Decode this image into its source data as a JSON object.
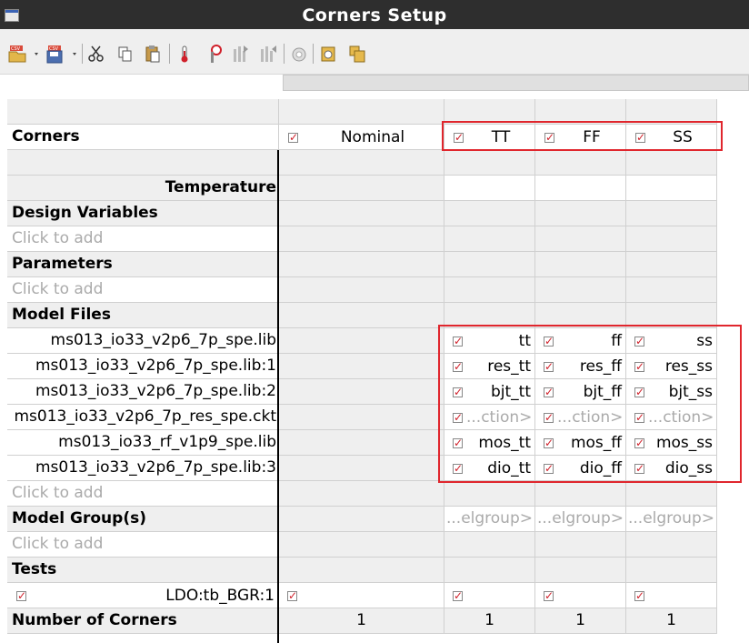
{
  "window": {
    "title": "Corners Setup"
  },
  "toolbar": {
    "icons": [
      "open-csv-icon",
      "save-csv-icon",
      "cut-icon",
      "copy-icon",
      "paste-icon",
      "add-temperature-icon",
      "add-variable-icon",
      "add-model-icon",
      "add-parameter-icon",
      "remove-icon",
      "settings-icon",
      "corners-icon"
    ]
  },
  "columns": [
    {
      "name": "Nominal",
      "checked": true
    },
    {
      "name": "TT",
      "checked": true
    },
    {
      "name": "FF",
      "checked": true
    },
    {
      "name": "SS",
      "checked": true
    }
  ],
  "labels": {
    "corners": "Corners",
    "temperature": "Temperature",
    "design_variables": "Design Variables",
    "parameters": "Parameters",
    "model_files": "Model Files",
    "model_groups": "Model Group(s)",
    "tests": "Tests",
    "number_of_corners": "Number of Corners",
    "click_to_add": "Click to add"
  },
  "model_files": [
    {
      "file": "ms013_io33_v2p6_7p_spe.lib",
      "tt": "tt",
      "ff": "ff",
      "ss": "ss",
      "hint": false
    },
    {
      "file": "ms013_io33_v2p6_7p_spe.lib:1",
      "tt": "res_tt",
      "ff": "res_ff",
      "ss": "res_ss",
      "hint": false
    },
    {
      "file": "ms013_io33_v2p6_7p_spe.lib:2",
      "tt": "bjt_tt",
      "ff": "bjt_ff",
      "ss": "bjt_ss",
      "hint": false
    },
    {
      "file": "ms013_io33_v2p6_7p_res_spe.ckt",
      "tt": "...ction>",
      "ff": "...ction>",
      "ss": "...ction>",
      "hint": true
    },
    {
      "file": "ms013_io33_rf_v1p9_spe.lib",
      "tt": "mos_tt",
      "ff": "mos_ff",
      "ss": "mos_ss",
      "hint": false
    },
    {
      "file": "ms013_io33_v2p6_7p_spe.lib:3",
      "tt": "dio_tt",
      "ff": "dio_ff",
      "ss": "dio_ss",
      "hint": false
    }
  ],
  "model_group_hint": "...elgroup>",
  "test": {
    "name": "LDO:tb_BGR:1",
    "checked": true
  },
  "number_of_corners": {
    "nominal": "1",
    "tt": "1",
    "ff": "1",
    "ss": "1"
  },
  "highlight_color": "#e0262d"
}
